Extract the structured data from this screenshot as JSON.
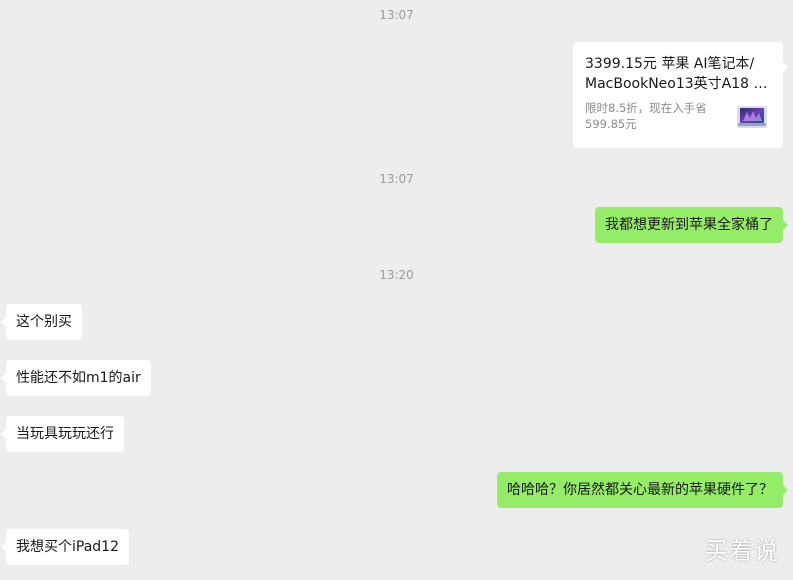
{
  "timestamps": [
    "13:07",
    "13:07",
    "13:20"
  ],
  "product_card": {
    "title_line1": "3399.15元  苹果 AI笔记本/",
    "title_line2": "MacBookNeo13英寸A18 P...",
    "subtitle": "限时8.5折，现在入手省599.85元",
    "thumbnail_icon": "laptop-product-icon"
  },
  "messages": [
    {
      "side": "right",
      "text": "我都想更新到苹果全家桶了"
    },
    {
      "side": "left",
      "text": "这个别买"
    },
    {
      "side": "left",
      "text": "性能还不如m1的air"
    },
    {
      "side": "left",
      "text": "当玩具玩玩还行"
    },
    {
      "side": "right",
      "text": "哈哈哈？你居然都关心最新的苹果硬件了？"
    },
    {
      "side": "left",
      "text": "我想买个iPad12"
    }
  ],
  "watermark": "买着说",
  "colors": {
    "background": "#ededed",
    "sent_bubble": "#95ec69",
    "received_bubble": "#ffffff",
    "timestamp": "#9a9a9a"
  }
}
